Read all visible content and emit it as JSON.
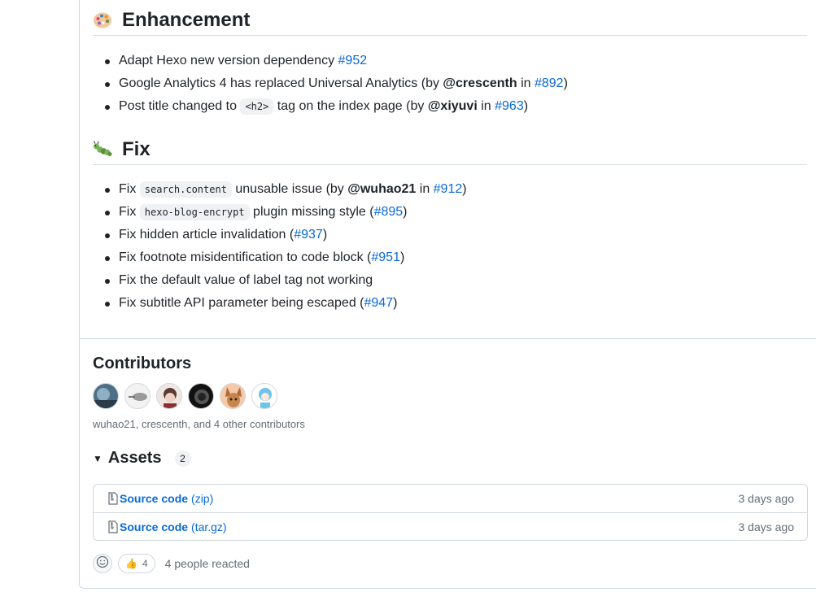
{
  "enhancement": {
    "title": "Enhancement",
    "icon": "artist-palette-icon",
    "items": [
      {
        "text": "Adapt Hexo new version dependency ",
        "issue": "#952"
      },
      {
        "pre": "Google Analytics 4 has replaced Universal Analytics (by ",
        "user": "@crescenth",
        "mid": " in ",
        "issue": "#892",
        "post": ")"
      },
      {
        "pre": "Post title changed to ",
        "code": "<h2>",
        "mid1": " tag on the index page (by ",
        "user": "@xiyuvi",
        "mid2": " in ",
        "issue": "#963",
        "post": ")"
      }
    ]
  },
  "fix": {
    "title": "Fix",
    "icon": "bug-icon",
    "items": [
      {
        "pre": "Fix ",
        "code": "search.content",
        "mid1": " unusable issue (by ",
        "user": "@wuhao21",
        "mid2": " in ",
        "issue": "#912",
        "post": ")"
      },
      {
        "pre": "Fix ",
        "code": "hexo-blog-encrypt",
        "mid1": " plugin missing style (",
        "issue": "#895",
        "post": ")"
      },
      {
        "pre": "Fix hidden article invalidation (",
        "issue": "#937",
        "post": ")"
      },
      {
        "pre": "Fix footnote misidentification to code block (",
        "issue": "#951",
        "post": ")"
      },
      {
        "pre": "Fix the default value of label tag not working"
      },
      {
        "pre": "Fix subtitle API parameter being escaped (",
        "issue": "#947",
        "post": ")"
      }
    ]
  },
  "contributors": {
    "title": "Contributors",
    "summary": "wuhao21, crescenth, and 4 other contributors",
    "avatar_count": 6
  },
  "assets": {
    "title": "Assets",
    "count": "2",
    "items": [
      {
        "name": "Source code",
        "ext": "(zip)",
        "date": "3 days ago"
      },
      {
        "name": "Source code",
        "ext": "(tar.gz)",
        "date": "3 days ago"
      }
    ]
  },
  "reactions": {
    "thumbs_count": "4",
    "summary": "4 people reacted"
  },
  "colors": {
    "link": "#0969da",
    "muted": "#656d76",
    "border": "#d0d7de"
  }
}
